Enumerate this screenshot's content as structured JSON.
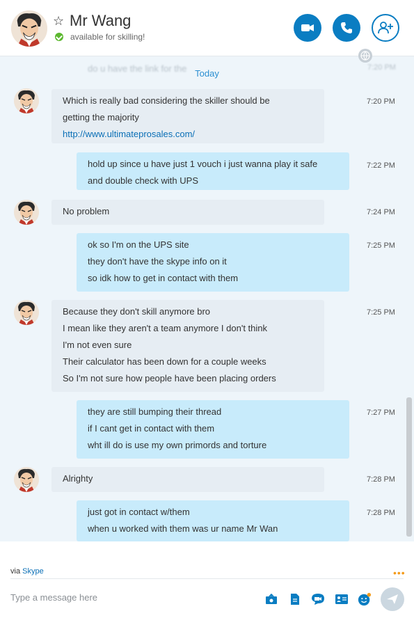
{
  "header": {
    "contact_name": "Mr Wang",
    "status_text": "available for skilling!",
    "favorite_icon": "star-outline-icon",
    "buttons": {
      "video_call": "video-camera-icon",
      "voice_call": "phone-icon",
      "add_people": "add-person-icon"
    }
  },
  "conversation": {
    "clipped_message": "do u have the link for the",
    "clipped_time": "7:20 PM",
    "date_divider": "Today",
    "messages": [
      {
        "side": "in",
        "lines": [
          "Which is really bad considering the skiller should be",
          "getting the majority"
        ],
        "link": "http://www.ultimateprosales.com/",
        "time": "7:20 PM"
      },
      {
        "side": "out",
        "lines": [
          "hold up since u have just 1 vouch i just wanna play it safe",
          "and double check with UPS"
        ],
        "time": "7:22 PM"
      },
      {
        "side": "in",
        "lines": [
          "No problem"
        ],
        "time": "7:24 PM"
      },
      {
        "side": "out",
        "lines": [
          "ok so I'm on the UPS site",
          "they don't have the skype info on it",
          "so idk how to get in contact with them"
        ],
        "time": "7:25 PM"
      },
      {
        "side": "in",
        "lines": [
          "Because they don't skill anymore bro",
          "I mean like they aren't a team anymore I don't think",
          "I'm not even sure",
          "Their calculator has been down for a couple weeks",
          "So I'm not sure how people have been placing orders"
        ],
        "time": "7:25 PM"
      },
      {
        "side": "out",
        "lines": [
          "they are still bumping their thread",
          "if I cant get in contact with them",
          "wht ill do is use my own primords and torture"
        ],
        "time": "7:27 PM"
      },
      {
        "side": "in",
        "lines": [
          "Alrighty"
        ],
        "time": "7:28 PM"
      },
      {
        "side": "out",
        "lines": [
          "just got in contact w/them",
          "when u worked with them was ur name Mr Wan"
        ],
        "time": "7:28 PM"
      }
    ]
  },
  "footer": {
    "via_prefix": "via",
    "via_link": "Skype",
    "more_label": "•••",
    "composer_placeholder": "Type a message here",
    "icons": [
      "send-media-icon",
      "send-file-icon",
      "video-message-icon",
      "send-contact-icon",
      "emoticon-icon"
    ],
    "send_icon": "send-arrow-icon"
  },
  "colors": {
    "accent": "#0a7dc2",
    "incoming_bubble": "#e6edf3",
    "outgoing_bubble": "#c8ebfb",
    "conversation_bg": "#eef5fa",
    "status_online": "#5cb82f",
    "link": "#0a6fb6"
  }
}
